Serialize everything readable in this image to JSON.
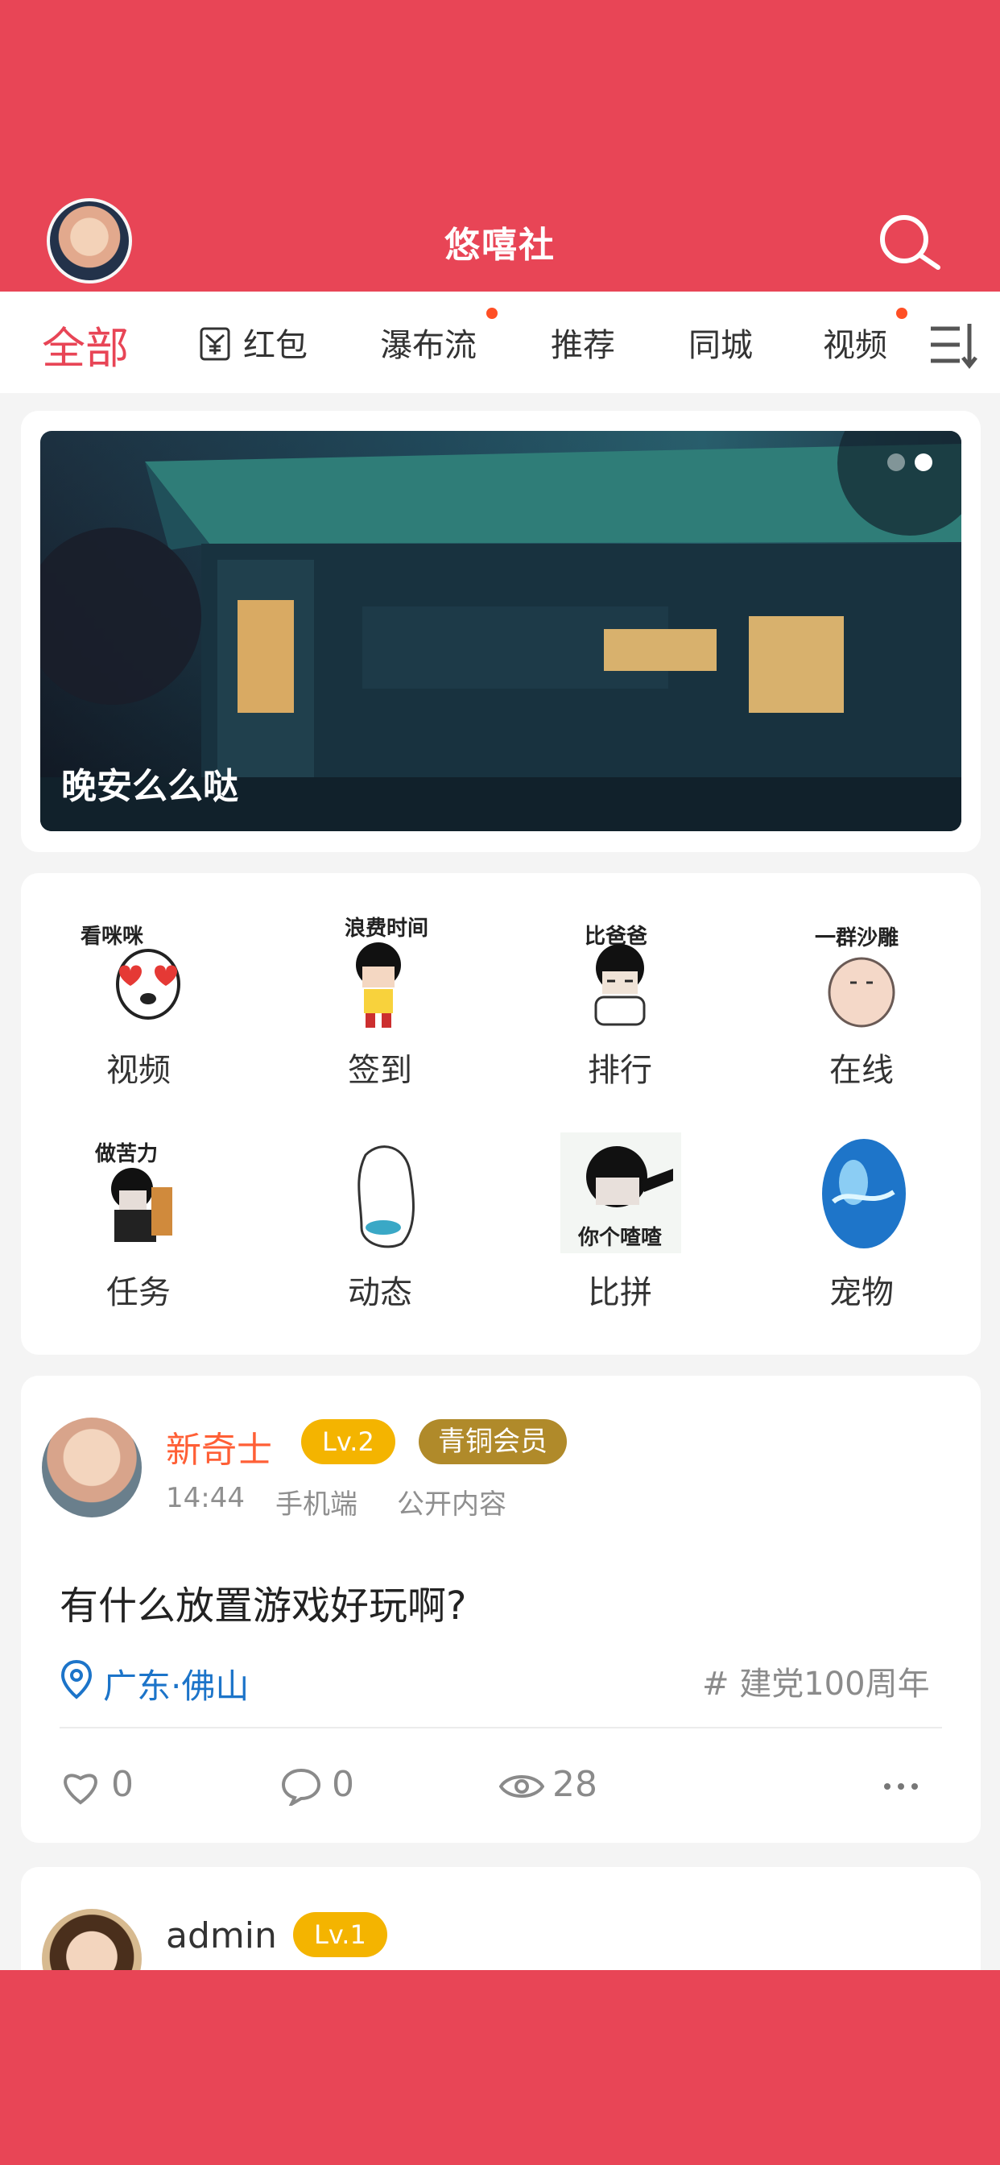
{
  "app": {
    "title": "悠嘻社",
    "accent_color": "#e84556",
    "search_icon": "search-icon"
  },
  "tabs": [
    {
      "label": "全部",
      "active": true,
      "has_dot": false
    },
    {
      "label": "红包",
      "icon": "red-envelope-icon",
      "has_dot": false
    },
    {
      "label": "瀑布流",
      "has_dot": true
    },
    {
      "label": "推荐",
      "has_dot": false
    },
    {
      "label": "同城",
      "has_dot": false
    },
    {
      "label": "视频",
      "has_dot": true
    }
  ],
  "tabs_menu_icon": "list-sort-icon",
  "banner": {
    "caption": "晚安么么哒",
    "active_page": 2,
    "pages": 2
  },
  "feature_grid": [
    {
      "label": "视频",
      "caption": "看咪咪",
      "icon": "cartoon-heart-eyes-icon"
    },
    {
      "label": "签到",
      "caption": "浪费时间",
      "icon": "cartoon-boy-icon"
    },
    {
      "label": "排行",
      "caption": "比爸爸",
      "icon": "cartoon-thinking-icon"
    },
    {
      "label": "在线",
      "caption": "一群沙雕",
      "icon": "cartoon-blob-icon"
    },
    {
      "label": "任务",
      "caption": "做苦力",
      "icon": "cartoon-worker-icon"
    },
    {
      "label": "动态",
      "caption": "",
      "icon": "cartoon-ghost-icon"
    },
    {
      "label": "比拼",
      "caption": "你个喳喳",
      "icon": "cartoon-pointing-icon"
    },
    {
      "label": "宠物",
      "caption": "",
      "icon": "blue-egg-icon"
    }
  ],
  "post1": {
    "username": "新奇士",
    "level": "Lv.2",
    "vip": "青铜会员",
    "time": "14:44",
    "device": "手机端",
    "visibility": "公开内容",
    "content": "有什么放置游戏好玩啊?",
    "location": "广东·佛山",
    "topic": "# 建党100周年",
    "likes": "0",
    "comments": "0",
    "views": "28"
  },
  "post2": {
    "username": "admin",
    "level": "Lv.1"
  }
}
